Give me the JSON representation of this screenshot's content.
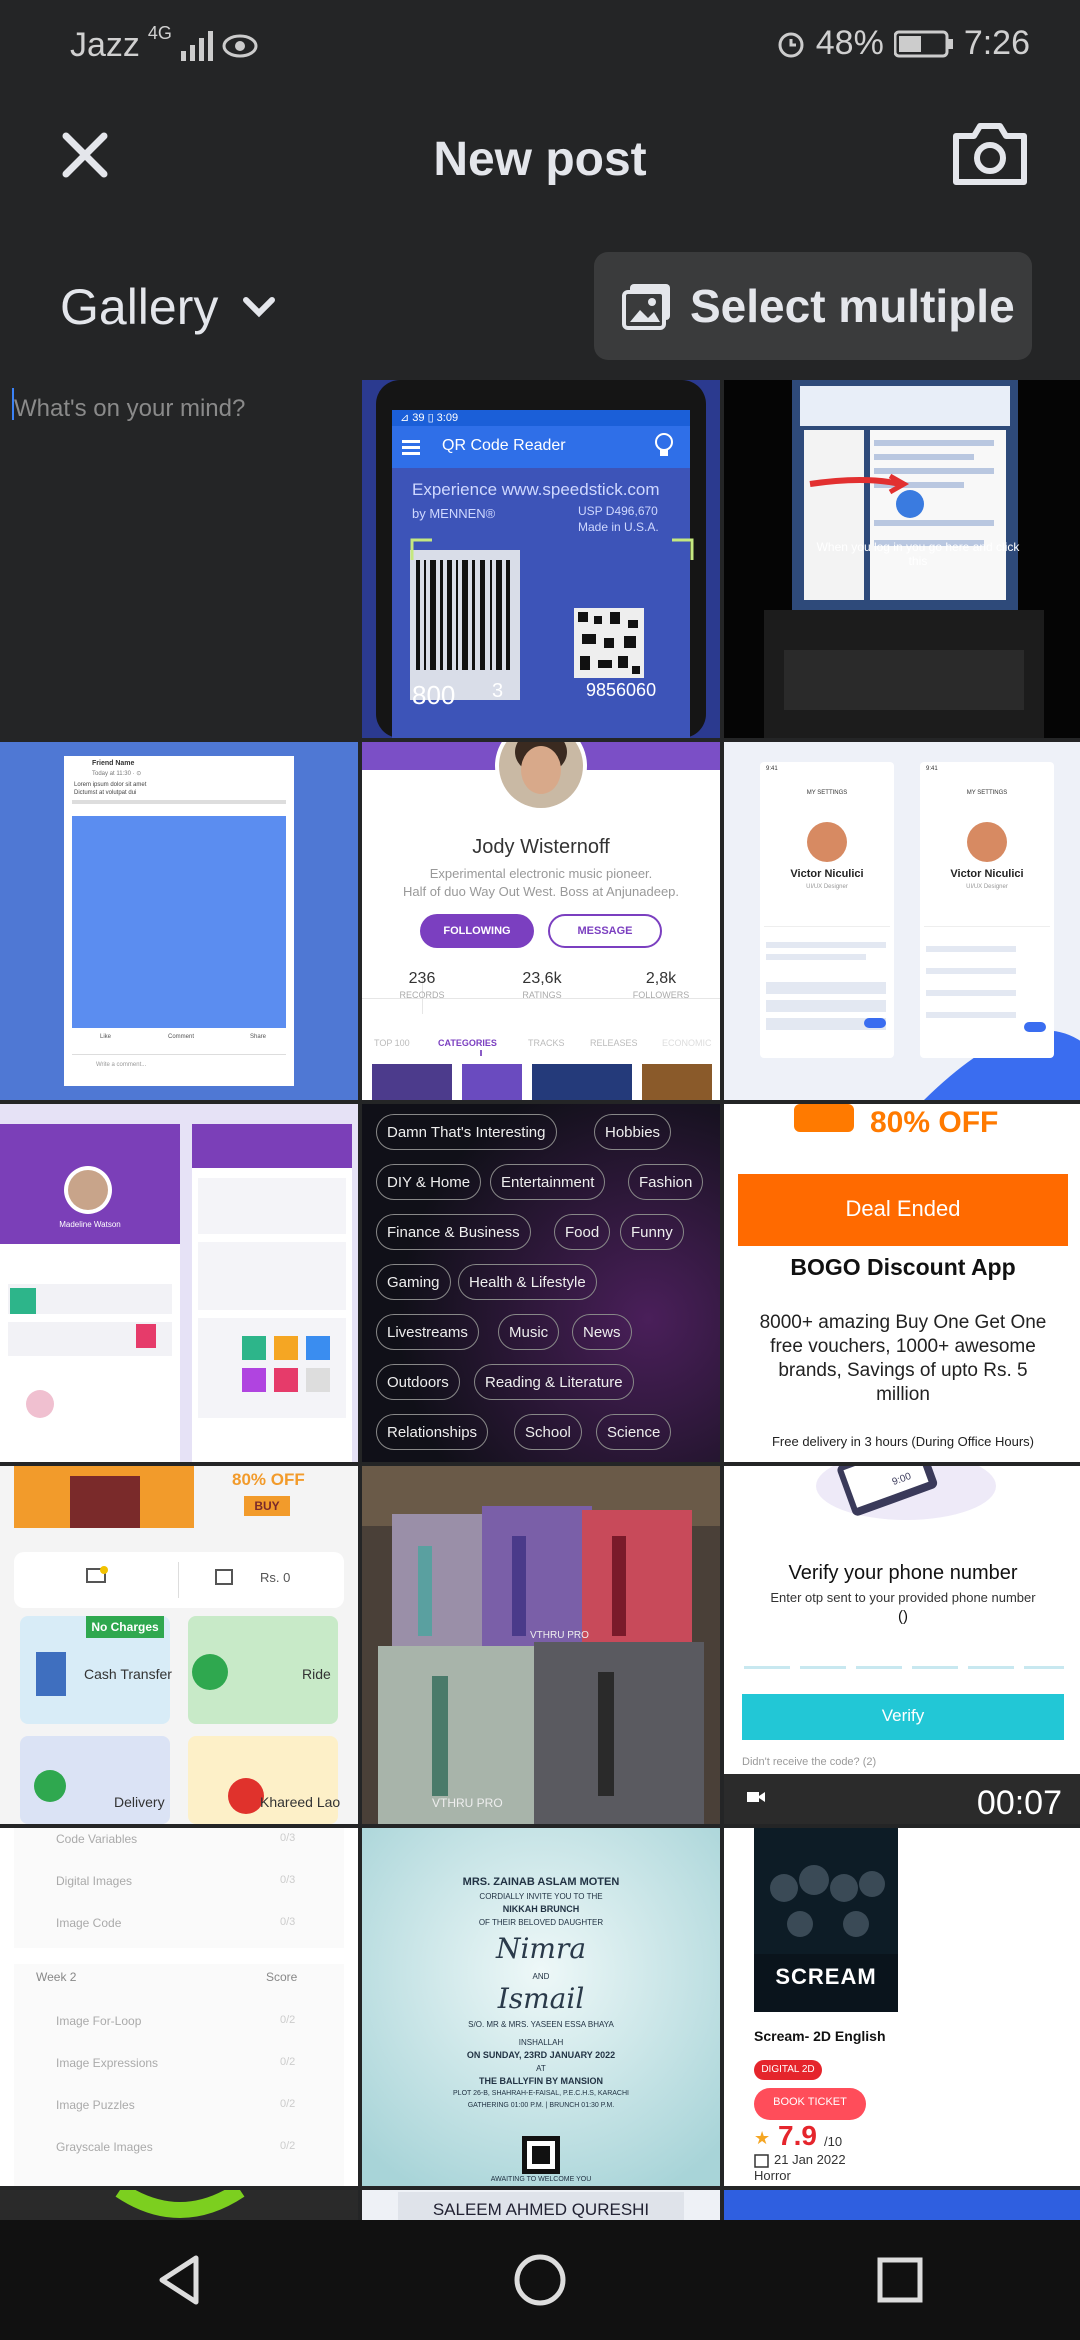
{
  "status_bar": {
    "carrier": "Jazz",
    "network": "4G",
    "battery": "48%",
    "time": "7:26"
  },
  "header": {
    "title": "New post"
  },
  "toolbar": {
    "gallery_label": "Gallery",
    "select_multiple_label": "Select multiple"
  },
  "compose": {
    "placeholder": "What's on your mind?"
  },
  "thumbs": {
    "qr": {
      "app_bar": "QR Code Reader",
      "status": "⊿ 39 ▯ 3:09",
      "text1": "Experience www.speedstick.com",
      "text2": "by MENNEN®",
      "text3": "USP D496,670",
      "text4": "Made in U.S.A.",
      "num1": "800",
      "num2": "3",
      "num3": "9856060"
    },
    "laptop": {
      "caption": "When you log in you go here and click this"
    },
    "post": {
      "name": "Friend Name",
      "line1": "Today at 11:30 · ⊙",
      "line2": "Lorem ipsum dolor sit amet",
      "line3": "Dictumst at volutpat dui",
      "like": "Like",
      "comment": "Comment",
      "share": "Share",
      "comment_placeholder": "Write a comment..."
    },
    "profile": {
      "name": "Jody Wisternoff",
      "bio1": "Experimental electronic music pioneer.",
      "bio2": "Half of duo Way Out West. Boss at Anjunadeep.",
      "following": "FOLLOWING",
      "message": "MESSAGE",
      "stats": [
        {
          "value": "236",
          "label": "RECORDS"
        },
        {
          "value": "23,6k",
          "label": "RATINGS"
        },
        {
          "value": "2,8k",
          "label": "FOLLOWERS"
        }
      ],
      "tabs": [
        "TOP 100",
        "CATEGORIES",
        "TRACKS",
        "RELEASES",
        "ECONOMIC"
      ]
    },
    "settings": {
      "title": "MY SETTINGS",
      "name": "Victor Niculici",
      "role": "UI/UX Designer",
      "time": "9:41"
    },
    "madeline": {
      "name": "Madeline Watson"
    },
    "topics": {
      "chips": [
        [
          "Damn That's Interesting",
          "Hobbies"
        ],
        [
          "DIY & Home",
          "Entertainment",
          "Fashion"
        ],
        [
          "Finance & Business",
          "Food",
          "Funny"
        ],
        [
          "Gaming",
          "Health & Lifestyle"
        ],
        [
          "Livestreams",
          "Music",
          "News"
        ],
        [
          "Outdoors",
          "Reading & Literature"
        ],
        [
          "Relationships",
          "School",
          "Science"
        ]
      ]
    },
    "bogo": {
      "off": "80% OFF",
      "deal": "Deal Ended",
      "title": "BOGO Discount App",
      "desc1": "8000+ amazing Buy One Get One",
      "desc2": "free vouchers, 1000+ awesome",
      "desc3": "brands, Savings of upto Rs. 5",
      "desc4": "million",
      "footer": "Free delivery in 3 hours (During Office Hours)"
    },
    "bykea": {
      "off": "80% OFF",
      "buy": "BUY",
      "balance": "Rs. 0",
      "no_charges": "No Charges",
      "cash": "Cash Transfer",
      "ride": "Ride",
      "delivery": "Delivery",
      "khareed": "Khareed Lao"
    },
    "vape": {
      "brand": "VTHRU PRO"
    },
    "verify": {
      "phone_time": "9:00",
      "title": "Verify your phone number",
      "subtitle": "Enter otp sent to your provided phone number",
      "value": "()",
      "button": "Verify",
      "resend": "Didn't receive the code? (2)",
      "duration": "00:07"
    },
    "course": {
      "items1": [
        "Code Variables",
        "Digital Images",
        "Image Code"
      ],
      "scores1": [
        "0/3",
        "0/3",
        "0/3"
      ],
      "week": "Week 2",
      "score": "Score",
      "items2": [
        "Image For-Loop",
        "Image Expressions",
        "Image Puzzles",
        "Grayscale Images"
      ],
      "scores2": [
        "0/2",
        "0/2",
        "0/2",
        "0/2"
      ]
    },
    "invite": {
      "l1": "MRS. ZAINAB ASLAM MOTEN",
      "l2": "CORDIALLY INVITE YOU TO THE",
      "l3": "NIKKAH BRUNCH",
      "l4": "OF THEIR BELOVED DAUGHTER",
      "bride": "Nimra",
      "and": "AND",
      "groom": "Ismail",
      "l5": "S/O. MR & MRS. YASEEN ESSA BHAYA",
      "l6": "INSHALLAH",
      "l7": "ON SUNDAY, 23RD JANUARY 2022",
      "l8": "AT",
      "l9": "THE BALLYFIN BY MANSION",
      "l10": "PLOT 26-B, SHAHRAH-E-FAISAL, P.E.C.H.S, KARACHI",
      "l11": "GATHERING 01:00 P.M. | BRUNCH 01:30 P.M.",
      "l12": "AWAITING TO WELCOME YOU"
    },
    "movie": {
      "poster_title": "SCREAM",
      "title": "Scream- 2D English",
      "format": "DIGITAL 2D",
      "book": "BOOK TICKET",
      "rating": "7.9",
      "rating_max": "/10",
      "date": "21 Jan 2022",
      "genre": "Horror"
    },
    "partial": {
      "name": "SALEEM AHMED QURESHI"
    }
  },
  "colors": {
    "background": "#242526",
    "accent_blue": "#1877f2",
    "orange": "#ff6a00",
    "teal": "#22c7d6"
  }
}
